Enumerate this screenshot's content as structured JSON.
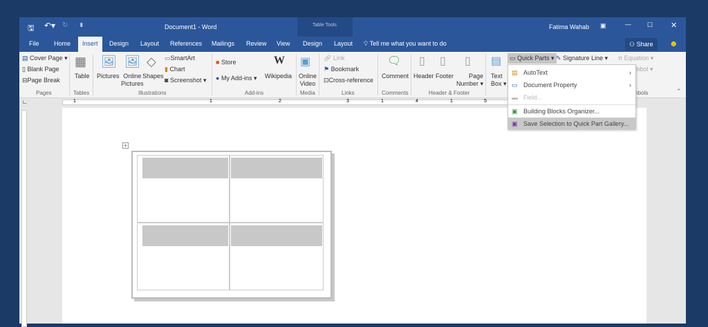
{
  "title": {
    "document": "Document1  -  Word",
    "table_tools": "Table Tools",
    "user": "Fatima Wahab"
  },
  "tabs": [
    "File",
    "Home",
    "Insert",
    "Design",
    "Layout",
    "References",
    "Mailings",
    "Review",
    "View",
    "Design",
    "Layout"
  ],
  "tell_me": "Tell me what you want to do",
  "share": "Share",
  "ribbon": {
    "pages": {
      "items": [
        "Cover Page",
        "Blank Page",
        "Page Break"
      ],
      "label": "Pages"
    },
    "tables": {
      "items": [
        "Table"
      ],
      "label": "Tables"
    },
    "illustrations": {
      "pictures": "Pictures",
      "online": "Online",
      "online2": "Pictures",
      "shapes": "Shapes",
      "smartart": "SmartArt",
      "chart": "Chart",
      "screenshot": "Screenshot",
      "label": "Illustrations"
    },
    "addins": {
      "store": "Store",
      "myaddins": "My Add-ins",
      "wikipedia": "Wikipedia",
      "label": "Add-ins"
    },
    "media": {
      "online": "Online",
      "video": "Video",
      "label": "Media"
    },
    "links": {
      "link": "Link",
      "bookmark": "Bookmark",
      "cross": "Cross-reference",
      "label": "Links"
    },
    "comments": {
      "comment": "Comment",
      "label": "Comments"
    },
    "header_footer": {
      "header": "Header",
      "footer": "Footer",
      "page": "Page",
      "number": "Number",
      "label": "Header & Footer"
    },
    "text": {
      "text": "Text",
      "box": "Box",
      "quick_parts": "Quick Parts",
      "signature": "Signature Line"
    },
    "symbols": {
      "equation": "Equation",
      "symbol": "mbol",
      "label": "mbols"
    }
  },
  "menu": [
    "AutoText",
    "Document Property",
    "Field...",
    "Building Blocks Organizer...",
    "Save Selection to Quick Part Gallery..."
  ],
  "ruler": [
    "1",
    "1",
    "2",
    "3",
    "1",
    "4",
    "1",
    "5"
  ]
}
